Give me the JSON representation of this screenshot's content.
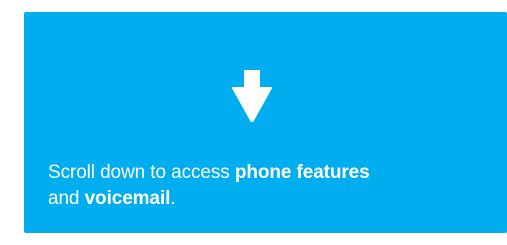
{
  "card": {
    "background_color": "#00aeef",
    "icon": "arrow-down-icon",
    "message": {
      "part1": "Scroll down to access ",
      "bold1": "phone features",
      "part2": "and ",
      "bold2": "voicemail",
      "part3": "."
    }
  }
}
